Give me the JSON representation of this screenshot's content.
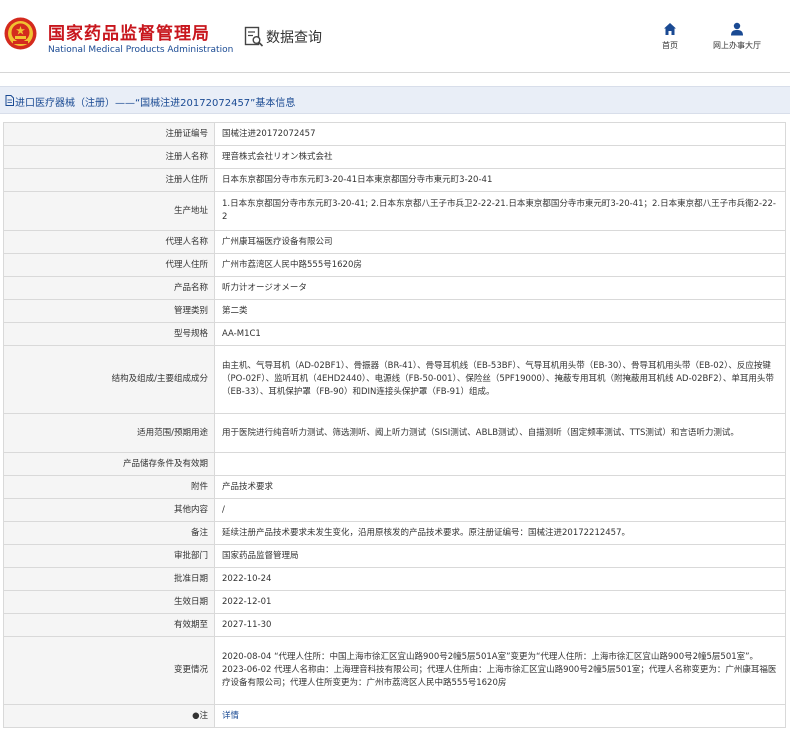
{
  "header": {
    "site_title": "国家药品监督管理局",
    "site_subtitle": "National Medical Products Administration",
    "query_label": "数据查询",
    "nav": [
      {
        "label": "首页",
        "icon": "home-icon"
      },
      {
        "label": "网上办事大厅",
        "icon": "user-icon"
      }
    ]
  },
  "breadcrumb": "进口医疗器械（注册）——“国械注进20172072457”基本信息",
  "colors": {
    "brand_red": "#c8161d",
    "brand_blue": "#1a4a93",
    "label_bg": "#f5f5f5",
    "bar_bg": "#e9eef7"
  },
  "rows": [
    {
      "label": "注册证编号",
      "value": "国械注进20172072457"
    },
    {
      "label": "注册人名称",
      "value": "理音株式会社リオン株式会社"
    },
    {
      "label": "注册人住所",
      "value": "日本东京都国分寺市东元町3-20-41日本東京都国分寺市東元町3-20-41"
    },
    {
      "label": "生产地址",
      "value": "1.日本东京都国分寺市东元町3-20-41; 2.日本东京都八王子市兵卫2-22-21.日本東京都国分寺市東元町3-20-41；2.日本東京都八王子市兵衞2-22-2"
    },
    {
      "label": "代理人名称",
      "value": "广州康耳福医疗设备有限公司"
    },
    {
      "label": "代理人住所",
      "value": "广州市荔湾区人民中路555号1620房"
    },
    {
      "label": "产品名称",
      "value": "听力计オージオメータ"
    },
    {
      "label": "管理类别",
      "value": "第二类"
    },
    {
      "label": "型号规格",
      "value": "AA-M1C1"
    },
    {
      "label": "结构及组成/主要组成成分",
      "value": "由主机、气导耳机（AD-02BF1）、骨振器（BR-41）、骨导耳机线（EB-53BF）、气导耳机用头带（EB-30）、骨导耳机用头带（EB-02）、反应按键（PO-02F）、监听耳机（4EHD2440）、电源线（FB-50-001）、保险丝（5PF19000）、掩蔽专用耳机（附掩蔽用耳机线 AD-02BF2）、单耳用头带（EB-33）、耳机保护罩（FB-90）和DIN连接头保护罩（FB-91）组成。"
    },
    {
      "label": "适用范围/预期用途",
      "value": "用于医院进行纯音听力测试、筛选测听、阈上听力测试（SISI测试、ABLB测试）、自描测听（固定频率测试、TTS测试）和言语听力测试。"
    },
    {
      "label": "产品储存条件及有效期",
      "value": ""
    },
    {
      "label": "附件",
      "value": "产品技术要求"
    },
    {
      "label": "其他内容",
      "value": "/"
    },
    {
      "label": "备注",
      "value": "延续注册产品技术要求未发生变化，沿用原核发的产品技术要求。原注册证编号：国械注进20172212457。"
    },
    {
      "label": "审批部门",
      "value": "国家药品监督管理局"
    },
    {
      "label": "批准日期",
      "value": "2022-10-24"
    },
    {
      "label": "生效日期",
      "value": "2022-12-01"
    },
    {
      "label": "有效期至",
      "value": "2027-11-30"
    }
  ],
  "changes": {
    "label": "变更情况",
    "entries": [
      "2020-08-04 “代理人住所：中国上海市徐汇区宜山路900号2幢5层501A室”变更为“代理人住所：上海市徐汇区宜山路900号2幢5层501室”。",
      "2023-06-02 代理人名称由：上海理音科技有限公司；代理人住所由：上海市徐汇区宜山路900号2幢5层501室；代理人名称变更为：广州康耳福医疗设备有限公司；代理人住所变更为：广州市荔湾区人民中路555号1620房"
    ]
  },
  "note": {
    "label": "●注",
    "value": "详情"
  }
}
